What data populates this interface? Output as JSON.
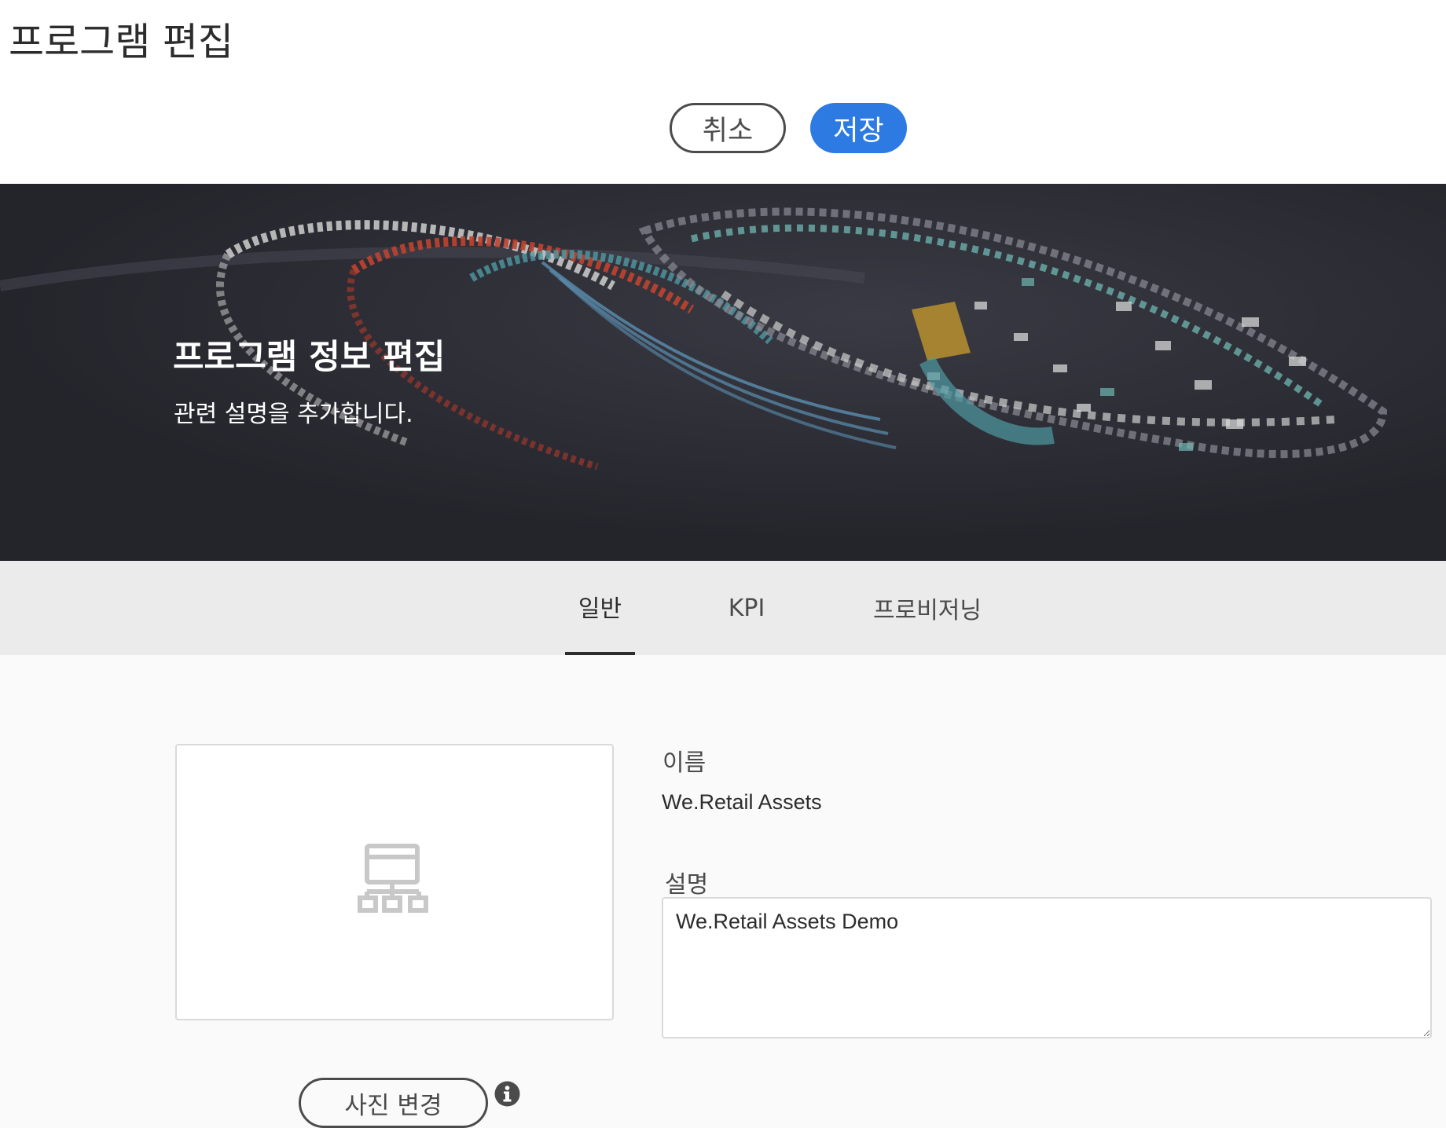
{
  "header": {
    "title": "프로그램 편집",
    "cancel_label": "취소",
    "save_label": "저장"
  },
  "hero": {
    "title": "프로그램 정보 편집",
    "subtitle": "관련 설명을 추가합니다."
  },
  "tabs": [
    {
      "label": "일반",
      "active": true
    },
    {
      "label": "KPI",
      "active": false
    },
    {
      "label": "프로비저닝",
      "active": false
    }
  ],
  "form": {
    "thumbnail_icon": "sitemap-icon",
    "change_photo_label": "사진 변경",
    "info_icon": "info-icon",
    "name_label": "이름",
    "name_value": "We.Retail Assets",
    "description_label": "설명",
    "description_value": "We.Retail Assets Demo"
  },
  "colors": {
    "primary_button": "#2d7ae3",
    "hero_background": "#2a2a32",
    "tabbar_background": "#ebebeb",
    "page_background": "#fafafa"
  }
}
